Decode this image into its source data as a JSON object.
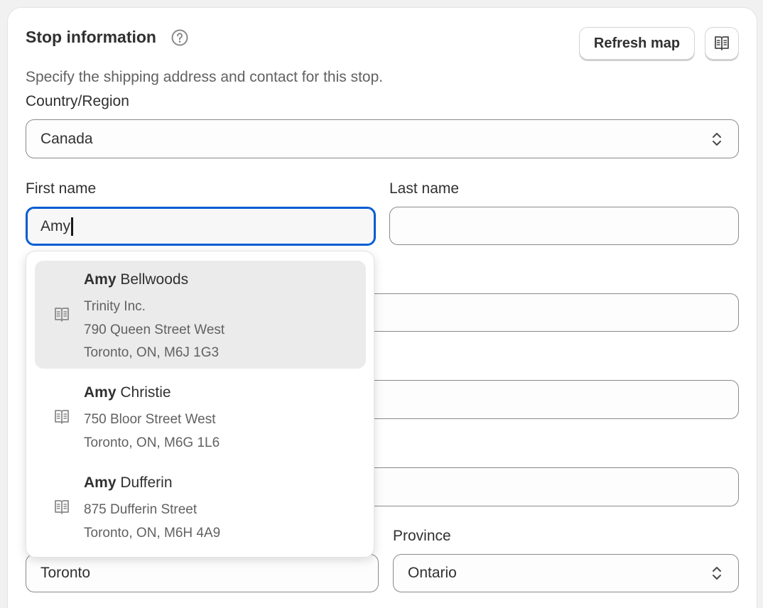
{
  "header": {
    "title": "Stop information",
    "subtitle": "Specify the shipping address and contact for this stop.",
    "refresh_label": "Refresh map"
  },
  "country": {
    "label": "Country/Region",
    "value": "Canada"
  },
  "first_name": {
    "label": "First name",
    "value": "Amy"
  },
  "last_name": {
    "label": "Last name",
    "value": ""
  },
  "city": {
    "value": "Toronto"
  },
  "province": {
    "label": "Province",
    "value": "Ontario"
  },
  "suggestions": [
    {
      "match": "Amy",
      "rest": " Bellwoods",
      "line1": "Trinity Inc.",
      "line2": "790 Queen Street West",
      "line3": "Toronto, ON, M6J 1G3"
    },
    {
      "match": "Amy",
      "rest": " Christie",
      "line1": "750 Bloor Street West",
      "line2": "Toronto, ON, M6G 1L6"
    },
    {
      "match": "Amy",
      "rest": " Dufferin",
      "line1": "875 Dufferin Street",
      "line2": "Toronto, ON, M6H 4A9"
    }
  ],
  "colors": {
    "focus": "#005bd3",
    "text": "#303030",
    "muted": "#616161",
    "highlight": "#ebebeb"
  }
}
